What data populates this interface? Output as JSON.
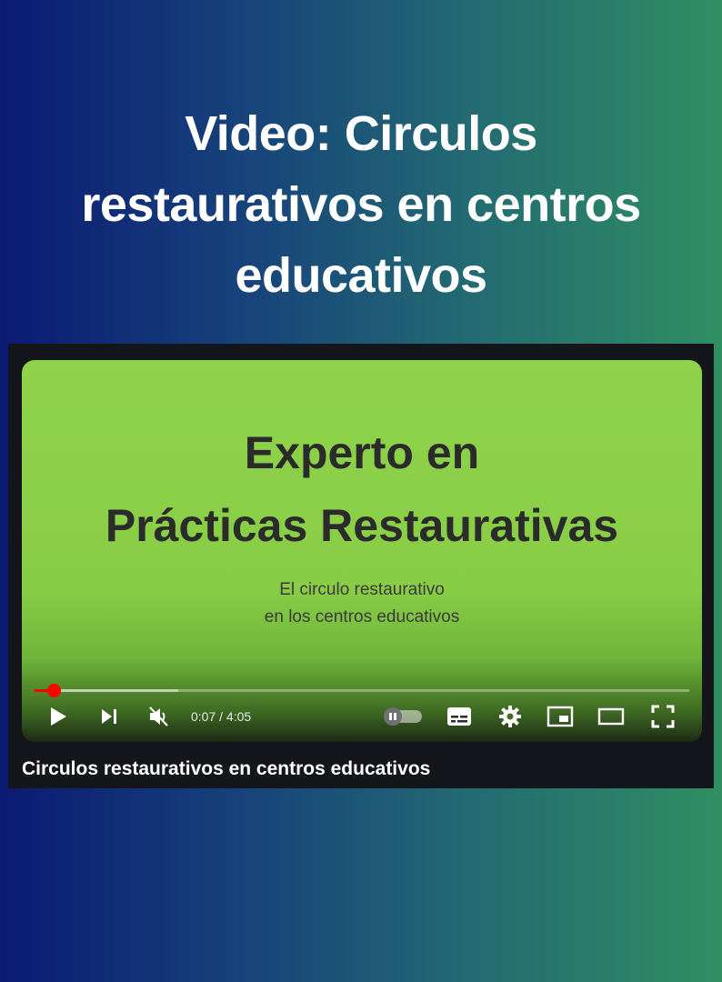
{
  "page": {
    "title": "Video: Circulos restaurativos en centros educativos"
  },
  "slide": {
    "title_line1": "Experto en",
    "title_line2": "Prácticas Restaurativas",
    "subtitle_line1": "El circulo restaurativo",
    "subtitle_line2": "en los centros educativos"
  },
  "player": {
    "time_display": "0:07 / 4:05",
    "progress_fraction": 0.029,
    "buffered_fraction": 0.22,
    "muted": true,
    "autoplay_on": false,
    "video_title": "Circulos restaurativos en centros educativos",
    "icons": [
      "play-icon",
      "next-icon",
      "mute-icon",
      "autoplay-toggle",
      "subtitles-icon",
      "settings-icon",
      "miniplayer-icon",
      "theater-icon",
      "fullscreen-icon"
    ]
  },
  "colors": {
    "progress": "#ff0000",
    "slide_background": "#8ed34a",
    "text_white": "#ffffff"
  }
}
